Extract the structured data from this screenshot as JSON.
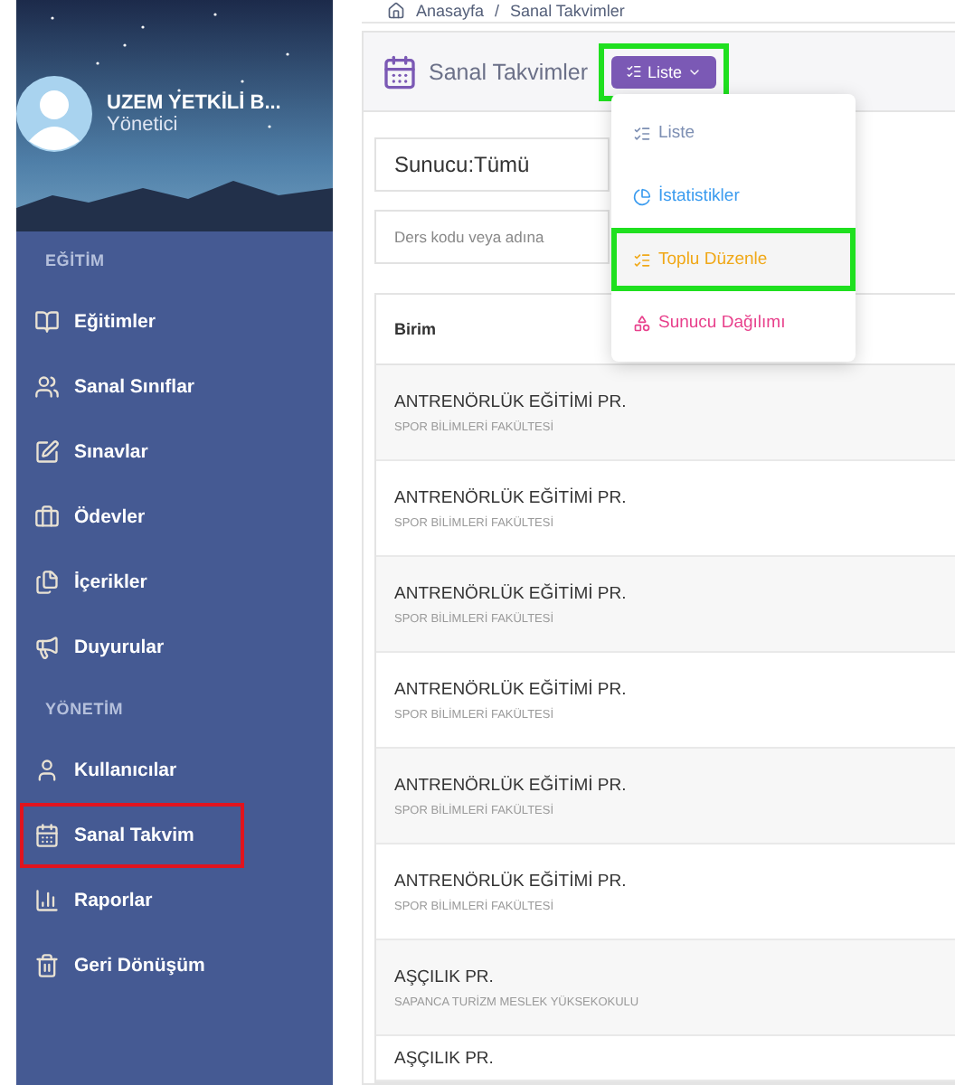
{
  "user": {
    "name": "UZEM YETKİLİ B...",
    "role": "Yönetici"
  },
  "sidebar": {
    "items": [
      {
        "kind": "section",
        "label": "EĞİTİM"
      },
      {
        "kind": "item",
        "label": "Eğitimler",
        "selected": false
      },
      {
        "kind": "item",
        "label": "Sanal Sınıflar",
        "selected": false
      },
      {
        "kind": "item",
        "label": "Sınavlar",
        "selected": false
      },
      {
        "kind": "item",
        "label": "Ödevler",
        "selected": false
      },
      {
        "kind": "item",
        "label": "İçerikler",
        "selected": false
      },
      {
        "kind": "item",
        "label": "Duyurular",
        "selected": false
      },
      {
        "kind": "section",
        "label": "YÖNETİM"
      },
      {
        "kind": "item",
        "label": "Kullanıcılar",
        "selected": false
      },
      {
        "kind": "item",
        "label": "Sanal Takvim",
        "selected": true
      },
      {
        "kind": "item",
        "label": "Raporlar",
        "selected": false
      },
      {
        "kind": "item",
        "label": "Geri Dönüşüm",
        "selected": false
      }
    ]
  },
  "breadcrumb": [
    "Anasayfa",
    "/",
    "Sanal Takvimler"
  ],
  "page_title": "Sanal Takvimler",
  "view_button": {
    "label": "Liste",
    "highlighted": true,
    "expanded": true
  },
  "view_menu": [
    {
      "label": "Liste",
      "color": "#7d8fb3",
      "highlighted": false
    },
    {
      "label": "İstatistikler",
      "color": "#3a9bef",
      "highlighted": false
    },
    {
      "label": "Toplu Düzenle",
      "color": "#f0a818",
      "highlighted": true
    },
    {
      "label": "Sunucu Dağılımı",
      "color": "#e8418c",
      "highlighted": false
    }
  ],
  "presenter_select": {
    "value": "Sunucu:Tümü"
  },
  "search": {
    "placeholder": "Ders kodu veya adına"
  },
  "table": {
    "columns": [
      "Birim"
    ],
    "rows": [
      {
        "title": "ANTRENÖRLÜK EĞİTİMİ PR.",
        "subtitle": "SPOR BİLİMLERİ FAKÜLTESİ"
      },
      {
        "title": "ANTRENÖRLÜK EĞİTİMİ PR.",
        "subtitle": "SPOR BİLİMLERİ FAKÜLTESİ"
      },
      {
        "title": "ANTRENÖRLÜK EĞİTİMİ PR.",
        "subtitle": "SPOR BİLİMLERİ FAKÜLTESİ"
      },
      {
        "title": "ANTRENÖRLÜK EĞİTİMİ PR.",
        "subtitle": "SPOR BİLİMLERİ FAKÜLTESİ"
      },
      {
        "title": "ANTRENÖRLÜK EĞİTİMİ PR.",
        "subtitle": "SPOR BİLİMLERİ FAKÜLTESİ"
      },
      {
        "title": "ANTRENÖRLÜK EĞİTİMİ PR.",
        "subtitle": "SPOR BİLİMLERİ FAKÜLTESİ"
      },
      {
        "title": "AŞÇILIK PR.",
        "subtitle": "SAPANCA TURİZM MESLEK YÜKSEKOKULU"
      },
      {
        "title": "AŞÇILIK PR."
      }
    ]
  }
}
